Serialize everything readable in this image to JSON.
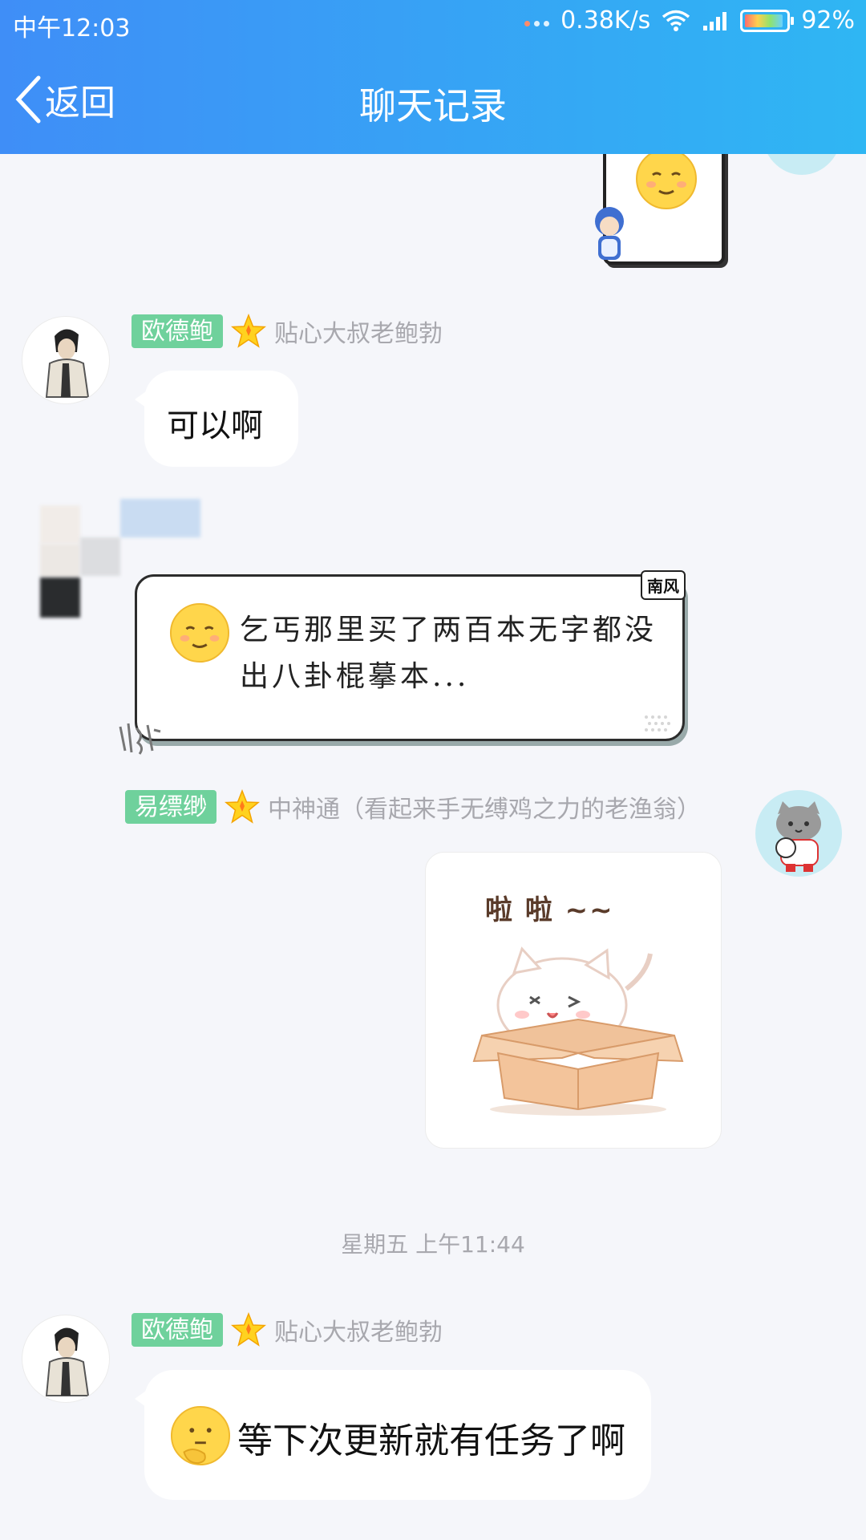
{
  "status": {
    "time": "中午12:03",
    "speed": "0.38K/s",
    "battery": "92%"
  },
  "header": {
    "back_label": "返回",
    "title": "聊天记录"
  },
  "messages": [
    {
      "badge": "欧德鲍",
      "nick": "贴心大叔老鲍勃",
      "text": "可以啊"
    },
    {
      "text": "乞丐那里买了两百本无字都没出八卦棍摹本...",
      "tag": "南风"
    },
    {
      "badge": "易缥缈",
      "nick": "中神通（看起来手无缚鸡之力的老渔翁）",
      "sticker_text": "啦 啦 ~~"
    },
    {
      "badge": "欧德鲍",
      "nick": "贴心大叔老鲍勃",
      "text": "等下次更新就有任务了啊"
    }
  ],
  "divider_time": "星期五 上午11:44",
  "colors": {
    "header_start": "#3f8ef7",
    "header_end": "#2fb6f3",
    "badge_green": "#6fd19c",
    "background": "#f5f6fa"
  }
}
